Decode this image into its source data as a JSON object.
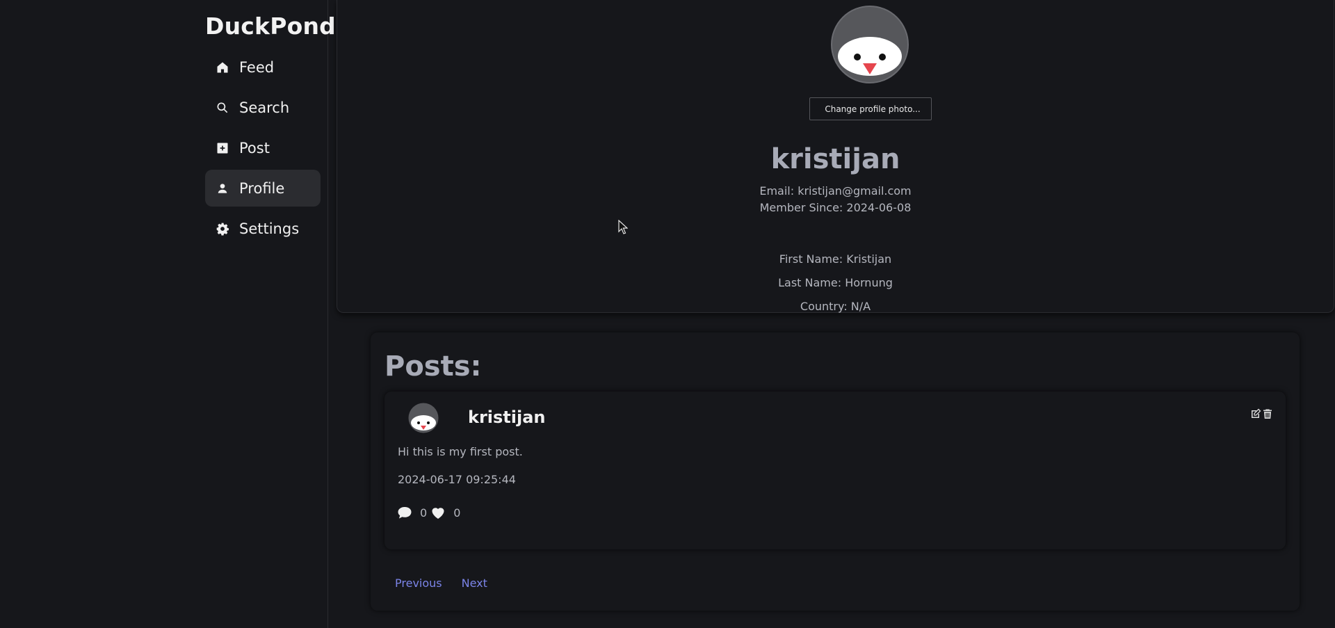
{
  "app": {
    "brand": "DuckPond",
    "accent": "#7b84e8",
    "background": "#16171b"
  },
  "sidebar": {
    "items": [
      {
        "label": "Feed",
        "icon": "home-icon",
        "active": false
      },
      {
        "label": "Search",
        "icon": "search-icon",
        "active": false
      },
      {
        "label": "Post",
        "icon": "plus-square-icon",
        "active": false
      },
      {
        "label": "Profile",
        "icon": "person-icon",
        "active": true
      },
      {
        "label": "Settings",
        "icon": "gear-icon",
        "active": false
      }
    ]
  },
  "profile": {
    "avatar_icon": "penguin-avatar-icon",
    "change_photo_label": "Change profile photo...",
    "username": "kristijan",
    "email": "Email: kristijan@gmail.com",
    "member_since": "Member Since: 2024-06-08",
    "first_name": "First Name: Kristijan",
    "last_name": "Last Name: Hornung",
    "country": "Country: N/A"
  },
  "posts": {
    "heading": "Posts:",
    "items": [
      {
        "author": "kristijan",
        "text": "Hi this is my first post.",
        "timestamp": "2024-06-17 09:25:44",
        "comments": "0",
        "likes": "0"
      }
    ],
    "previous_label": "Previous",
    "next_label": "Next"
  }
}
